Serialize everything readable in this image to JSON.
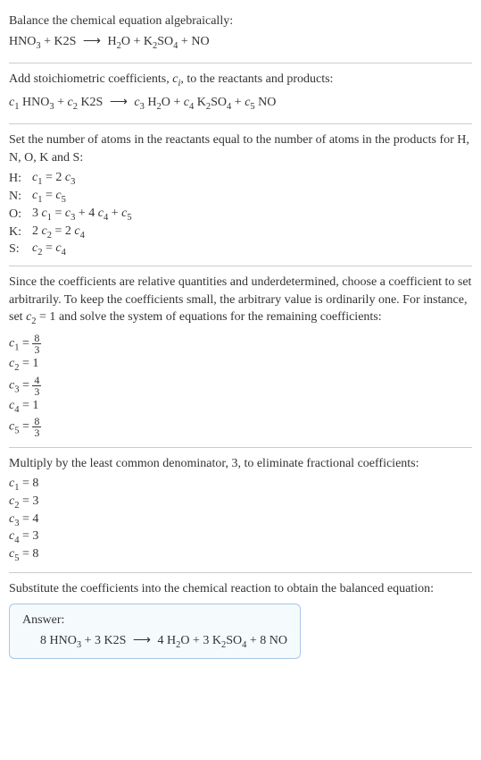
{
  "intro": {
    "line1": "Balance the chemical equation algebraically:",
    "eq_hno3": "HNO",
    "eq_plus": " + ",
    "eq_k2s": "K2S",
    "eq_arrow": "⟶",
    "eq_h2o": "H",
    "eq_o": "O",
    "eq_k2so4": "K",
    "eq_so4": "SO",
    "eq_no": "NO"
  },
  "stoich": {
    "line1a": "Add stoichiometric coefficients, ",
    "ci": "c",
    "ci_sub": "i",
    "line1b": ", to the reactants and products:",
    "c1": "c",
    "n1": "1",
    "t1": " HNO",
    "s1": "3",
    "c2": "c",
    "n2": "2",
    "t2": " K2S",
    "arrow": "⟶",
    "c3": "c",
    "n3": "3",
    "t3": " H",
    "s3a": "2",
    "t3b": "O",
    "c4": "c",
    "n4": "4",
    "t4": " K",
    "s4a": "2",
    "t4b": "SO",
    "s4c": "4",
    "c5": "c",
    "n5": "5",
    "t5": " NO"
  },
  "atoms": {
    "intro1": "Set the number of atoms in the reactants equal to the number of atoms in the products for H, N, O, K and S:",
    "rows": [
      {
        "label": "H:",
        "lhs_c": "c",
        "lhs_n": "1",
        "eq": " = 2 ",
        "rhs_c": "c",
        "rhs_n": "3"
      },
      {
        "label": "N:",
        "lhs_c": "c",
        "lhs_n": "1",
        "eq": " = ",
        "rhs_c": "c",
        "rhs_n": "5"
      }
    ],
    "rowO": {
      "label": "O:",
      "pre": "3 ",
      "c1": "c",
      "n1": "1",
      "eq": " = ",
      "c3": "c",
      "n3": "3",
      "p1": " + 4 ",
      "c4": "c",
      "n4": "4",
      "p2": " + ",
      "c5": "c",
      "n5": "5"
    },
    "rowK": {
      "label": "K:",
      "pre": "2 ",
      "c2": "c",
      "n2": "2",
      "eq": " = 2 ",
      "c4": "c",
      "n4": "4"
    },
    "rowS": {
      "label": "S:",
      "c2": "c",
      "n2": "2",
      "eq": " = ",
      "c4": "c",
      "n4": "4"
    }
  },
  "solve": {
    "intro1": "Since the coefficients are relative quantities and underdetermined, choose a coefficient to set arbitrarily. To keep the coefficients small, the arbitrary value is ordinarily one. For instance, set ",
    "cset": "c",
    "cset_n": "2",
    "cset_eq": " = 1",
    "intro2": " and solve the system of equations for the remaining coefficients:",
    "c1": {
      "c": "c",
      "n": "1",
      "eq": " = ",
      "top": "8",
      "bot": "3"
    },
    "c2": {
      "c": "c",
      "n": "2",
      "eq": " = 1"
    },
    "c3": {
      "c": "c",
      "n": "3",
      "eq": " = ",
      "top": "4",
      "bot": "3"
    },
    "c4": {
      "c": "c",
      "n": "4",
      "eq": " = 1"
    },
    "c5": {
      "c": "c",
      "n": "5",
      "eq": " = ",
      "top": "8",
      "bot": "3"
    }
  },
  "mult": {
    "intro": "Multiply by the least common denominator, 3, to eliminate fractional coefficients:",
    "items": [
      {
        "c": "c",
        "n": "1",
        "v": " = 8"
      },
      {
        "c": "c",
        "n": "2",
        "v": " = 3"
      },
      {
        "c": "c",
        "n": "3",
        "v": " = 4"
      },
      {
        "c": "c",
        "n": "4",
        "v": " = 3"
      },
      {
        "c": "c",
        "n": "5",
        "v": " = 8"
      }
    ]
  },
  "final": {
    "intro": "Substitute the coefficients into the chemical reaction to obtain the balanced equation:",
    "answer_label": "Answer:",
    "p1": "8 HNO",
    "s1": "3",
    "p2": " + 3 K2S ",
    "arrow": "⟶",
    "p3": " 4 H",
    "s3": "2",
    "p3b": "O + 3 K",
    "s3c": "2",
    "p3d": "SO",
    "s3e": "4",
    "p3f": " + 8 NO"
  }
}
